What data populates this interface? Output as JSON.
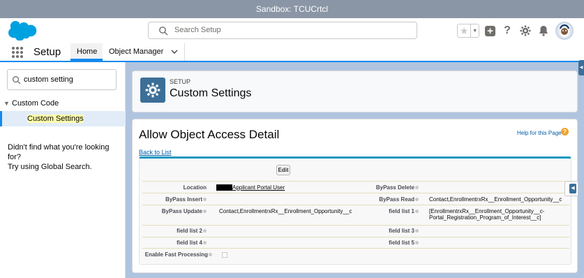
{
  "sandbox_bar": {
    "text": "Sandbox: TCUCrtcl"
  },
  "header": {
    "search_placeholder": "Search Setup",
    "colors": {
      "brand": "#00a1e0",
      "accent": "#1589ee"
    }
  },
  "nav": {
    "app_name": "Setup",
    "tabs": [
      {
        "label": "Home"
      },
      {
        "label": "Object Manager"
      }
    ]
  },
  "sidebar": {
    "quick_find_value": "custom setting",
    "tree": [
      {
        "label": "Custom Code",
        "expanded": true,
        "children": [
          {
            "label": "Custom Settings",
            "selected": true
          }
        ]
      }
    ],
    "hint_line1": "Didn't find what you're looking for?",
    "hint_line2": "Try using Global Search."
  },
  "page_header": {
    "label": "SETUP",
    "title": "Custom Settings"
  },
  "detail_page": {
    "title": "Allow Object Access Detail",
    "help_link": "Help for this Page",
    "back_link": "Back to List",
    "edit_button": "Edit",
    "fields": {
      "location_label": "Location",
      "location_value": "Applicant Portal User",
      "bypass_delete_label": "ByPass Delete",
      "bypass_insert_label": "ByPass Insert",
      "bypass_read_label": "ByPass Read",
      "bypass_read_value": "Contact,EnrollmentrxRx__Enrollment_Opportunity__c",
      "bypass_update_label": "ByPass Update",
      "bypass_update_value": "Contact,EnrollmentrxRx__Enrollment_Opportunity__c",
      "field_list_1_label": "field list 1",
      "field_list_1_value_line1": "[EnrollmentrxRx__Enrollment_Opportunity__c-",
      "field_list_1_value_line2": "Portal_Registration_Program_of_Interest__c]",
      "field_list_2_label": "field list 2",
      "field_list_3_label": "field list 3",
      "field_list_4_label": "field list 4",
      "field_list_5_label": "field list 5",
      "fast_processing_label": "Enable Fast Processing",
      "fast_processing_checked": false
    }
  }
}
